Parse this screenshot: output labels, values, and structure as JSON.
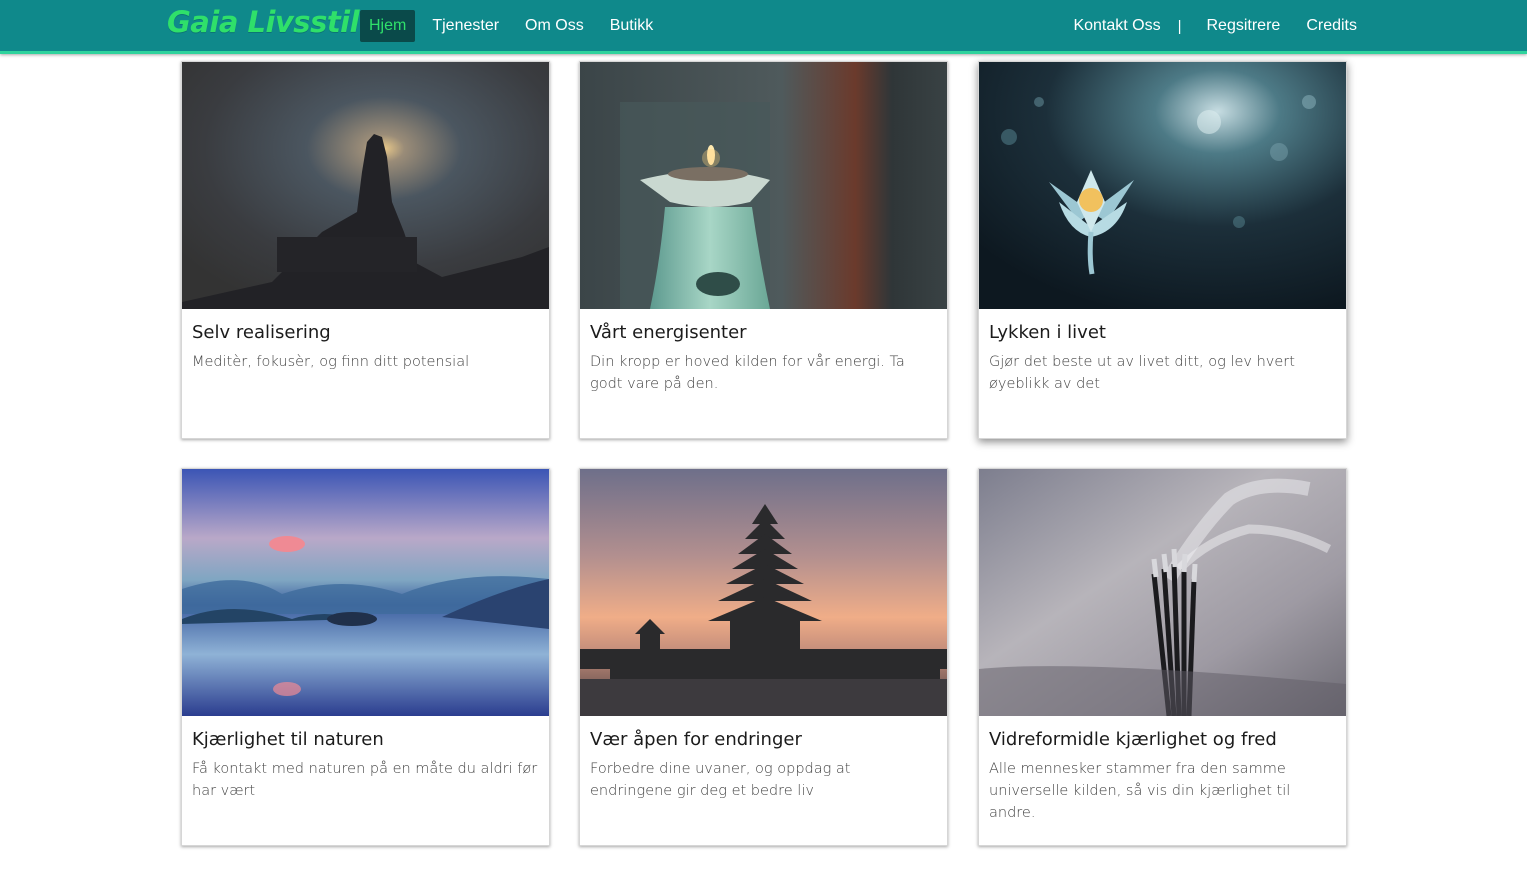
{
  "brand": "Gaia Livsstil",
  "nav": {
    "left": [
      "Hjem",
      "Tjenester",
      "Om Oss",
      "Butikk"
    ],
    "right": [
      "Kontakt Oss",
      "Regsitrere",
      "Credits"
    ],
    "separator": "|"
  },
  "cards": [
    {
      "title": "Selv realisering",
      "text": "Meditèr, fokusèr, og finn ditt potensial",
      "image": "meditation-silhouette"
    },
    {
      "title": "Vårt energisenter",
      "text": "Din kropp er hoved kilden for vår energi. Ta godt vare på den.",
      "image": "candle-oil-burner"
    },
    {
      "title": "Lykken i livet",
      "text": "Gjør det beste ut av livet ditt, og lev hvert øyeblikk av det",
      "image": "lotus-flower"
    },
    {
      "title": "Kjærlighet til naturen",
      "text": "Få kontakt med naturen på en måte du aldri før har vært",
      "image": "lake-mountains"
    },
    {
      "title": "Vær åpen for endringer",
      "text": "Forbedre dine uvaner, og oppdag at endringene gir deg et bedre liv",
      "image": "pagoda-temple"
    },
    {
      "title": "Vidreformidle kjærlighet og fred",
      "text": "Alle mennesker stammer fra den samme universelle kilden, så vis din kjærlighet til andre.",
      "image": "incense-sticks"
    }
  ],
  "colors": {
    "navbar": "#0f898b",
    "accent": "#2fe06a",
    "active_bg": "#0a4a4a"
  }
}
